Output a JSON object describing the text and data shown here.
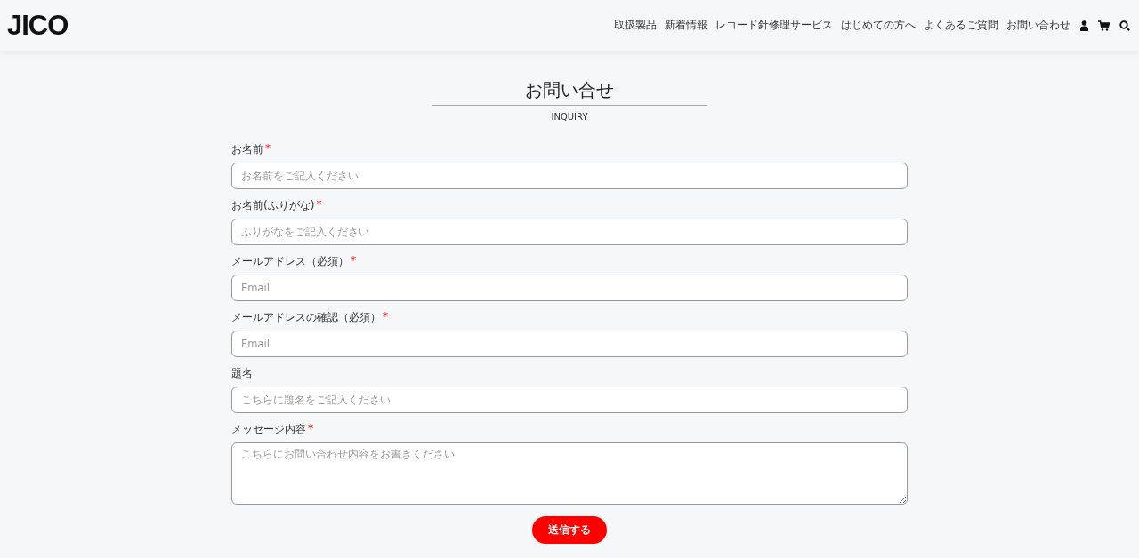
{
  "header": {
    "logo": "JICO",
    "nav": [
      "取扱製品",
      "新着情報",
      "レコード針修理サービス",
      "はじめての方へ",
      "よくあるご質問",
      "お問い合わせ"
    ]
  },
  "page": {
    "title": "お問い合せ",
    "subtitle": "INQUIRY"
  },
  "required_mark": "*",
  "fields": [
    {
      "label": "お名前",
      "required": true,
      "kind": "input",
      "placeholder": "お名前をご記入ください"
    },
    {
      "label": "お名前(ふりがな)",
      "required": true,
      "kind": "input",
      "placeholder": "ふりがなをご記入ください"
    },
    {
      "label": "メールアドレス（必須）",
      "required": true,
      "kind": "input",
      "placeholder": "Email"
    },
    {
      "label": "メールアドレスの確認（必須）",
      "required": true,
      "kind": "input",
      "placeholder": "Email"
    },
    {
      "label": "題名",
      "required": false,
      "kind": "input",
      "placeholder": "こちらに題名をご記入ください"
    },
    {
      "label": "メッセージ内容",
      "required": true,
      "kind": "textarea",
      "placeholder": "こちらにお問い合わせ内容をお書きください"
    }
  ],
  "submit": "送信する"
}
